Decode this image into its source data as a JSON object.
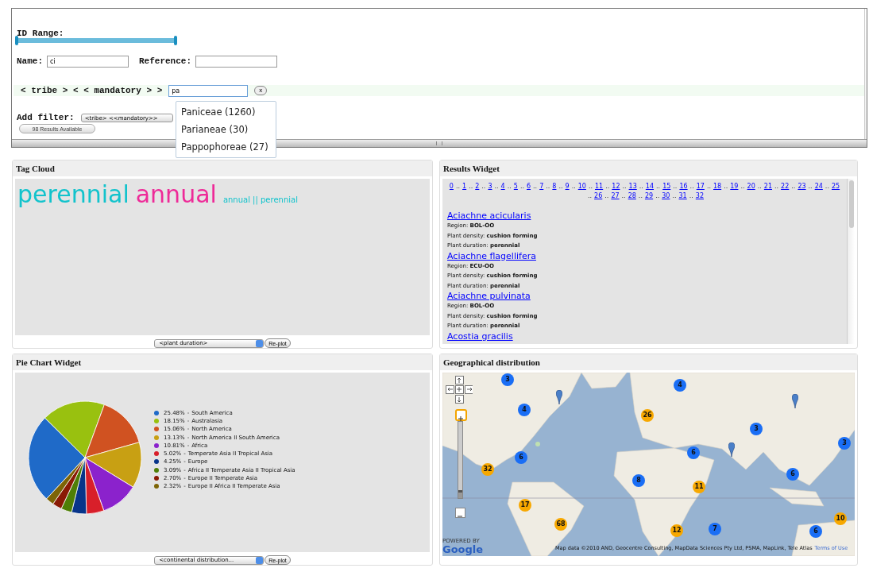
{
  "filters": {
    "id_range": {
      "label": "ID Range:",
      "level": 1.0
    },
    "name": {
      "label": "Name:",
      "value": "ci"
    },
    "reference": {
      "label": "Reference:"
    },
    "tribe_filter": {
      "label": "< tribe > < < mandatory > >",
      "value": "pa",
      "clear": "x"
    },
    "suggestions": [
      {
        "text": "Paniceae (1260)",
        "selected": false
      },
      {
        "text": "Parianeae (30)",
        "selected": false
      },
      {
        "text": "Pappophoreae (27)",
        "selected": false
      }
    ],
    "add_filter": {
      "label": "Add filter:",
      "value": "<tribe> <<mandatory>>"
    },
    "results_button": "98 Results Available"
  },
  "tag_cloud": {
    "title": "Tag Cloud",
    "tags": [
      {
        "text": "perennial",
        "color": "#12c3cc",
        "kind": "major"
      },
      {
        "text": "annual",
        "color": "#ee2a98",
        "kind": "major"
      },
      {
        "text": "annual || perennial",
        "color": "#12c3cc",
        "kind": "minor"
      }
    ],
    "select": "<plant duration>",
    "button": "Re-plot"
  },
  "results": {
    "title": "Results Widget",
    "separator": "..",
    "pages": [
      "0",
      "1",
      "2",
      "3",
      "4",
      "5",
      "6",
      "7",
      "8",
      "9",
      "10",
      "11",
      "12",
      "13",
      "14",
      "15",
      "16",
      "17",
      "18",
      "19",
      "20",
      "21",
      "22",
      "23",
      "24",
      "25",
      "26",
      "27",
      "28",
      "29",
      "30",
      "31",
      "32"
    ],
    "items": [
      {
        "name": "Aciachne acicularis",
        "details": [
          "Region: **BOL-OO**",
          "Plant density: **cushion forming**",
          "Plant duration: **perennial**"
        ]
      },
      {
        "name": "Aciachne flagellifera",
        "details": [
          "Region: **ECU-OO**",
          "Plant density: **cushion forming**",
          "Plant duration: **perennial**"
        ]
      },
      {
        "name": "Aciachne pulvinata",
        "details": [
          "Region: **BOL-OO**",
          "Plant density: **cushion forming**",
          "Plant duration: **perennial**"
        ]
      },
      {
        "name": "Acostia gracilis"
      }
    ]
  },
  "pie": {
    "title": "Pie Chart Widget",
    "legend_separator": "-",
    "legend": [
      {
        "percent": "25.48%",
        "color": "#1f6ac8"
      },
      {
        "percent": "18.15%",
        "color": "#99c10f"
      },
      {
        "percent": "15.06%",
        "color": "#d05221"
      },
      {
        "percent": "13.13%",
        "color": "#c8a013"
      },
      {
        "percent": "10.81%",
        "color": "#8b22cc"
      },
      {
        "percent": "5.02%",
        "color": "#d81f2a"
      },
      {
        "percent": "4.25%",
        "color": "#08358a"
      },
      {
        "percent": "3.09%",
        "color": "#4f7f06"
      },
      {
        "percent": "2.70%",
        "color": "#8a1a04"
      },
      {
        "percent": "2.32%",
        "color": "#7d6406"
      }
    ],
    "chart_data": {
      "type": "pie",
      "categories": [
        "South America",
        "Australasia",
        "North America",
        "North America II South America",
        "Africa",
        "Temperate Asia II Tropical Asia",
        "Europe",
        "Africa II Temperate Asia II Tropical Asia",
        "Europe II Temperate Asia",
        "Europe II Africa II Temperate Asia"
      ],
      "values": [
        25.48,
        18.15,
        15.06,
        13.13,
        10.81,
        5.02,
        4.25,
        3.09,
        2.7,
        2.32
      ]
    },
    "select": "<continental distribution...",
    "button": "Re-plot"
  },
  "map": {
    "title": "Geographical distribution",
    "markers": [
      {
        "count": "3",
        "color": "#1a6ef5"
      },
      {
        "count": "4",
        "color": "#1a6ef5"
      },
      {
        "count": "4",
        "color": "#1a6ef5"
      },
      {
        "count": "26",
        "color": "#f7a800"
      },
      {
        "count": "3",
        "color": "#1a6ef5"
      },
      {
        "count": "3",
        "color": "#1a6ef5"
      },
      {
        "count": "6",
        "color": "#1a6ef5"
      },
      {
        "count": "32",
        "color": "#f7a800"
      },
      {
        "count": "6",
        "color": "#1a6ef5"
      },
      {
        "count": "8",
        "color": "#1a6ef5"
      },
      {
        "count": "11",
        "color": "#f7a800"
      },
      {
        "count": "6",
        "color": "#1a6ef5"
      },
      {
        "count": "17",
        "color": "#f7a800"
      },
      {
        "count": "68",
        "color": "#f7a800"
      },
      {
        "count": "12",
        "color": "#f7a800"
      },
      {
        "count": "7",
        "color": "#1a6ef5"
      },
      {
        "count": "10",
        "color": "#f7a800"
      },
      {
        "count": "6",
        "color": "#1a6ef5"
      }
    ],
    "zoom": {
      "level": 0.1
    },
    "logo_caption": "POWERED BY",
    "logo": "Google",
    "attribution": "Map data ©2010 AND, Geocentre Consulting, MapData Sciences Pty Ltd, PSMA, MapLink, Tele Atlas",
    "terms": "Terms of Use"
  }
}
